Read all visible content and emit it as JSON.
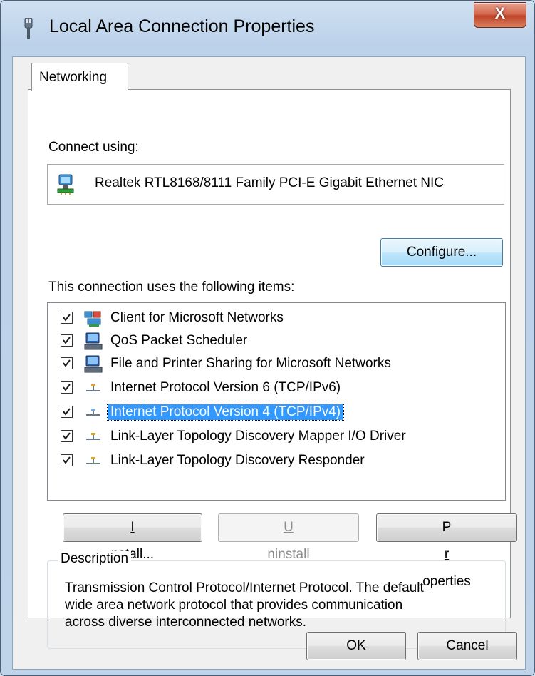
{
  "window": {
    "title": "Local Area Connection Properties",
    "close_glyph": "X"
  },
  "tabs": [
    {
      "label": "Networking",
      "selected": true
    }
  ],
  "connect_using": {
    "label": "Connect using:",
    "adapter_name": "Realtek RTL8168/8111 Family PCI-E Gigabit Ethernet NIC",
    "adapter_icon": "network-adapter-icon"
  },
  "configure_button": {
    "label": "Configure..."
  },
  "items_section": {
    "label_pre": "This c",
    "label_accel": "o",
    "label_post": "nnection uses the following items:",
    "items": [
      {
        "label": "Client for Microsoft Networks",
        "checked": true,
        "icon": "client-network-icon",
        "selected": false
      },
      {
        "label": "QoS Packet Scheduler",
        "checked": true,
        "icon": "service-computer-icon",
        "selected": false
      },
      {
        "label": "File and Printer Sharing for Microsoft Networks",
        "checked": true,
        "icon": "service-computer-icon",
        "selected": false
      },
      {
        "label": "Internet Protocol Version 6 (TCP/IPv6)",
        "checked": true,
        "icon": "protocol-icon",
        "selected": false
      },
      {
        "label": "Internet Protocol Version 4 (TCP/IPv4)",
        "checked": true,
        "icon": "protocol-icon",
        "selected": true
      },
      {
        "label": "Link-Layer Topology Discovery Mapper I/O Driver",
        "checked": true,
        "icon": "protocol-icon",
        "selected": false
      },
      {
        "label": "Link-Layer Topology Discovery Responder",
        "checked": true,
        "icon": "protocol-icon",
        "selected": false
      }
    ]
  },
  "buttons": {
    "install": {
      "accel": "I",
      "rest": "nstall..."
    },
    "uninstall": {
      "accel": "U",
      "rest": "ninstall",
      "disabled": true
    },
    "properties": {
      "pre": "P",
      "accel": "r",
      "rest": "operties"
    },
    "ok": {
      "label": "OK"
    },
    "cancel": {
      "label": "Cancel"
    }
  },
  "description": {
    "legend": "Description",
    "lines": [
      "Transmission Control Protocol/Internet Protocol. The default",
      "wide area network protocol that provides communication",
      "across diverse interconnected networks."
    ]
  },
  "colors": {
    "selection": "#3399ff",
    "close_button": "#c0452a",
    "default_button_border": "#3c7fb1"
  }
}
